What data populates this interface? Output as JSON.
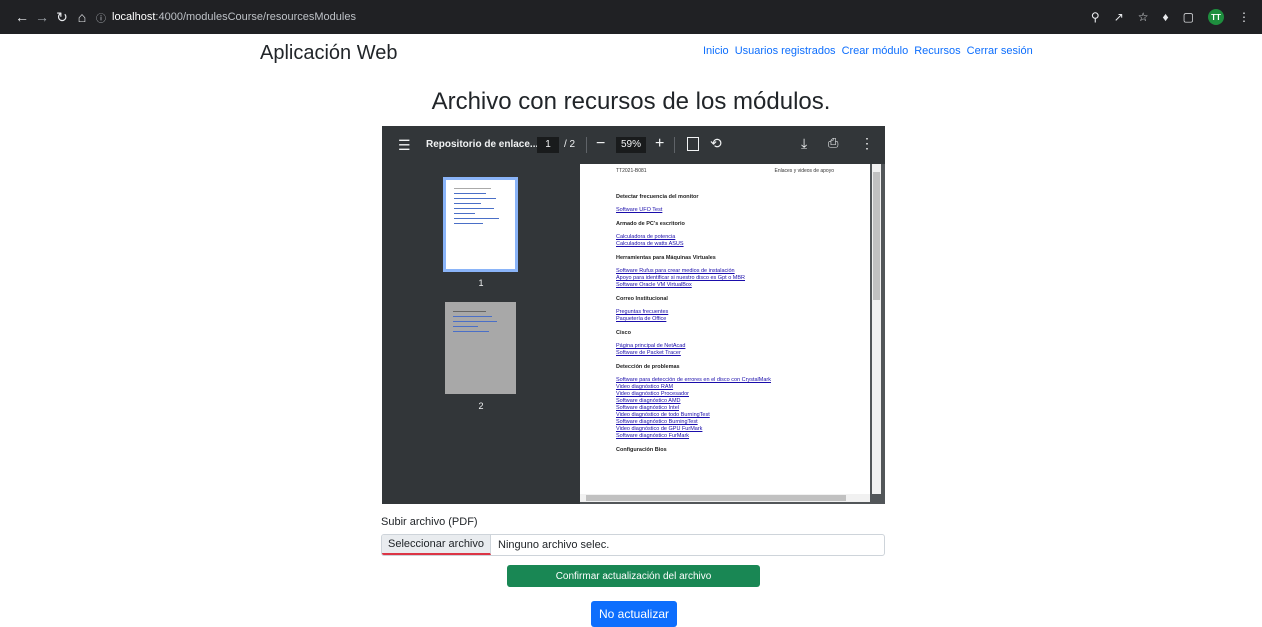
{
  "browser": {
    "url_host": "localhost",
    "url_rest": ":4000/modulesCourse/resourcesModules",
    "avatar_initials": "TT"
  },
  "header": {
    "brand": "Aplicación Web",
    "nav": [
      "Inicio",
      "Usuarios registrados",
      "Crear módulo",
      "Recursos",
      "Cerrar sesión"
    ]
  },
  "main": {
    "title": "Archivo con recursos de los módulos."
  },
  "pdf_viewer": {
    "doc_title": "Repositorio de enlace...",
    "current_page": "1",
    "total_pages": "/ 2",
    "zoom": "59%",
    "thumbnails": [
      "1",
      "2"
    ],
    "page": {
      "header_left": "TT2021-B081",
      "header_right": "Enlaces y videos de apoyo",
      "sections": [
        {
          "title": "Detectar frecuencia del monitor",
          "links": [
            "Software UFO Test"
          ]
        },
        {
          "title": "Armado de PC's escritorio",
          "links": [
            "Calculadora de potencia",
            "Calculadora de watts ASUS"
          ]
        },
        {
          "title": "Herramientas para Máquinas Virtuales",
          "links": [
            "Software Rufus para crear medios de instalación",
            "Apoyo para identificar si nuestro disco es Gpt o MBR",
            "Software Oracle VM VirtualBox"
          ]
        },
        {
          "title": "Correo Institucional",
          "links": [
            "Preguntas frecuentes",
            "Paquetería de Office"
          ]
        },
        {
          "title": "Cisco",
          "links": [
            "Página principal de NetAcad",
            "Software de Packet Tracer"
          ]
        },
        {
          "title": "Detección de problemas",
          "links": [
            "Software para detección de errores en el disco con CrystalMark",
            "Video diagnóstico RAM",
            "Video diagnóstico Procesador",
            "Software diagnóstico AMD",
            "Software diagnóstico Intel",
            "Video diagnóstico de todo BurningTest",
            "Software diagnóstico BurningTest",
            "Video diagnóstico de GPU FurMark",
            "Software diagnóstico FurMark"
          ]
        },
        {
          "title": "Configuración Bios",
          "links": []
        }
      ]
    }
  },
  "form": {
    "upload_label": "Subir archivo (PDF)",
    "file_button": "Seleccionar archivo",
    "file_status": "Ninguno archivo selec.",
    "confirm_button": "Confirmar actualización del archivo",
    "cancel_button": "No actualizar"
  }
}
